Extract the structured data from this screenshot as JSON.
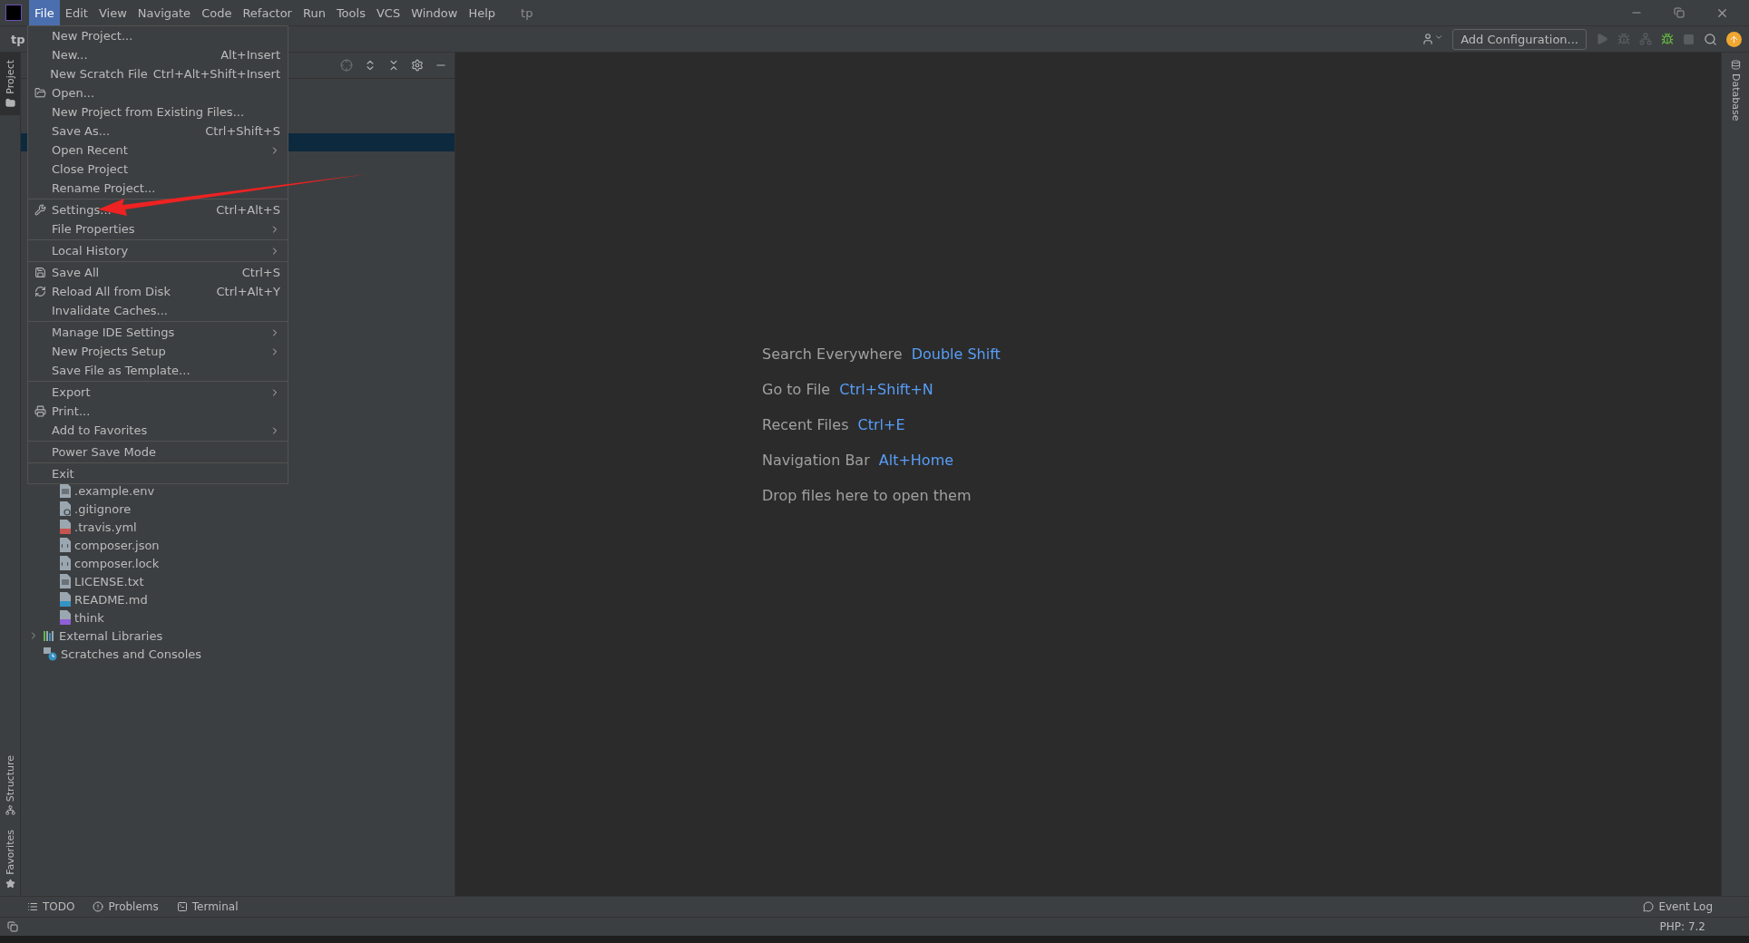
{
  "menu_bar": {
    "items": [
      {
        "label": "File",
        "selected": true
      },
      {
        "label": "Edit",
        "selected": false
      },
      {
        "label": "View",
        "selected": false
      },
      {
        "label": "Navigate",
        "selected": false
      },
      {
        "label": "Code",
        "selected": false
      },
      {
        "label": "Refactor",
        "selected": false
      },
      {
        "label": "Run",
        "selected": false
      },
      {
        "label": "Tools",
        "selected": false
      },
      {
        "label": "VCS",
        "selected": false
      },
      {
        "label": "Window",
        "selected": false
      },
      {
        "label": "Help",
        "selected": false
      }
    ],
    "project_title": "tp"
  },
  "toolbar": {
    "breadcrumb": "tp",
    "config_button": "Add Configuration..."
  },
  "left_stripe": {
    "top": [
      {
        "label": "Project",
        "selected": true
      }
    ],
    "bottom": [
      {
        "label": "Structure",
        "selected": false
      },
      {
        "label": "Favorites",
        "selected": false
      }
    ]
  },
  "right_stripe": [
    {
      "label": "Database",
      "selected": false
    }
  ],
  "file_menu": [
    {
      "kind": "plain",
      "label": "New Project...",
      "submenu": false
    },
    {
      "kind": "plain",
      "label": "New...",
      "shortcut": "Alt+Insert",
      "submenu": false
    },
    {
      "kind": "plain",
      "label": "New Scratch File",
      "shortcut": "Ctrl+Alt+Shift+Insert",
      "submenu": false
    },
    {
      "kind": "folder",
      "label": "Open...",
      "submenu": false
    },
    {
      "kind": "plain",
      "label": "New Project from Existing Files...",
      "submenu": false
    },
    {
      "kind": "plain",
      "label": "Save As...",
      "shortcut": "Ctrl+Shift+S",
      "submenu": false
    },
    {
      "kind": "plain",
      "label": "Open Recent",
      "submenu": true
    },
    {
      "kind": "plain",
      "label": "Close Project",
      "submenu": false
    },
    {
      "kind": "plain",
      "label": "Rename Project...",
      "submenu": false
    },
    {
      "kind": "separator"
    },
    {
      "kind": "wrench",
      "label": "Settings...",
      "shortcut": "Ctrl+Alt+S",
      "submenu": false
    },
    {
      "kind": "plain",
      "label": "File Properties",
      "submenu": true
    },
    {
      "kind": "separator"
    },
    {
      "kind": "plain",
      "label": "Local History",
      "submenu": true
    },
    {
      "kind": "separator"
    },
    {
      "kind": "save",
      "label": "Save All",
      "shortcut": "Ctrl+S",
      "submenu": false
    },
    {
      "kind": "reload",
      "label": "Reload All from Disk",
      "shortcut": "Ctrl+Alt+Y",
      "submenu": false
    },
    {
      "kind": "plain",
      "label": "Invalidate Caches...",
      "submenu": false
    },
    {
      "kind": "separator"
    },
    {
      "kind": "plain",
      "label": "Manage IDE Settings",
      "submenu": true
    },
    {
      "kind": "plain",
      "label": "New Projects Setup",
      "submenu": true
    },
    {
      "kind": "plain",
      "label": "Save File as Template...",
      "submenu": false
    },
    {
      "kind": "separator"
    },
    {
      "kind": "plain",
      "label": "Export",
      "submenu": true
    },
    {
      "kind": "print",
      "label": "Print...",
      "submenu": false
    },
    {
      "kind": "plain",
      "label": "Add to Favorites",
      "submenu": true
    },
    {
      "kind": "separator"
    },
    {
      "kind": "plain",
      "label": "Power Save Mode",
      "submenu": false
    },
    {
      "kind": "separator"
    },
    {
      "kind": "plain",
      "label": "Exit",
      "submenu": false
    }
  ],
  "project_tree": [
    {
      "children": [
        {
          "label": ".example.env",
          "kind": "text"
        },
        {
          "label": ".gitignore",
          "kind": "ignore"
        },
        {
          "label": ".travis.yml",
          "kind": "yml"
        },
        {
          "label": "composer.json",
          "kind": "json"
        },
        {
          "label": "composer.lock",
          "kind": "json"
        },
        {
          "label": "LICENSE.txt",
          "kind": "text"
        },
        {
          "label": "README.md",
          "kind": "md"
        },
        {
          "label": "think",
          "kind": "php"
        }
      ]
    },
    {
      "label": "External Libraries",
      "kind": "library",
      "expanded": false
    },
    {
      "label": "Scratches and Consoles",
      "kind": "scratch"
    }
  ],
  "editor_hints": [
    {
      "label": "Search Everywhere",
      "shortcut": "Double Shift"
    },
    {
      "label": "Go to File",
      "shortcut": "Ctrl+Shift+N"
    },
    {
      "label": "Recent Files",
      "shortcut": "Ctrl+E"
    },
    {
      "label": "Navigation Bar",
      "shortcut": "Alt+Home"
    },
    {
      "label": "Drop files here to open them"
    }
  ],
  "bottom_tabs": [
    {
      "label": "TODO"
    },
    {
      "label": "Problems"
    },
    {
      "label": "Terminal"
    }
  ],
  "event_log": "Event Log",
  "status_bar": {
    "php": "PHP: 7.2"
  }
}
